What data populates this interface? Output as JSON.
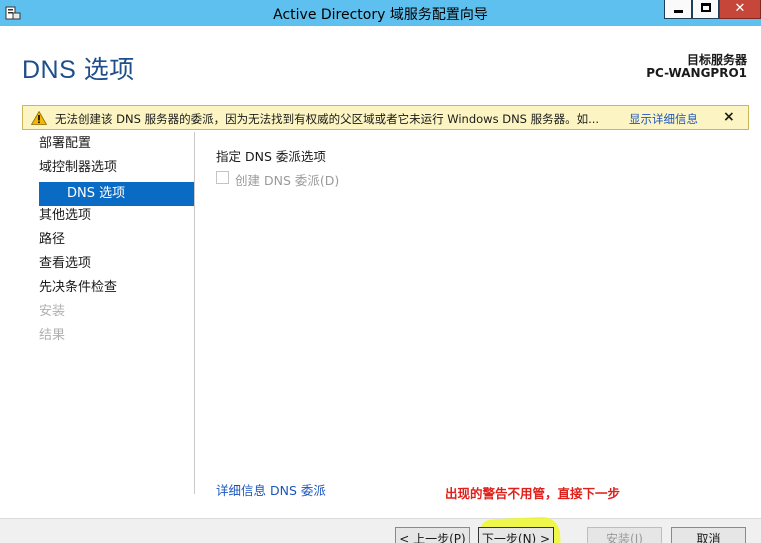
{
  "window": {
    "title": "Active Directory 域服务配置向导",
    "icon": "server-wizard-icon"
  },
  "header": {
    "page_title": "DNS 选项",
    "target_label": "目标服务器",
    "target_server": "PC-WANGPRO1"
  },
  "warning": {
    "icon": "warning-icon",
    "text": "无法创建该 DNS 服务器的委派，因为无法找到有权威的父区域或者它未运行 Windows DNS 服务器。如...",
    "link": "显示详细信息",
    "close": "×"
  },
  "nav": {
    "items": [
      {
        "label": "部署配置",
        "state": "normal"
      },
      {
        "label": "域控制器选项",
        "state": "normal"
      },
      {
        "label": "DNS 选项",
        "state": "active"
      },
      {
        "label": "其他选项",
        "state": "normal"
      },
      {
        "label": "路径",
        "state": "normal"
      },
      {
        "label": "查看选项",
        "state": "normal"
      },
      {
        "label": "先决条件检查",
        "state": "normal"
      },
      {
        "label": "安装",
        "state": "disabled"
      },
      {
        "label": "结果",
        "state": "disabled"
      }
    ]
  },
  "main": {
    "section_label": "指定 DNS 委派选项",
    "checkbox_label": "创建 DNS 委派(D)",
    "checkbox_checked": false,
    "more_link": "详细信息 DNS 委派",
    "annotation": "出现的警告不用管，直接下一步"
  },
  "footer": {
    "prev": "< 上一步(P)",
    "next": "下一步(N) >",
    "install": "安装(I)",
    "cancel": "取消"
  },
  "colors": {
    "titlebar": "#5ec0ee",
    "accent": "#0a6bc4",
    "link": "#1b55c0",
    "warning_bg": "#fcf5c3",
    "annotation": "#e0201a",
    "highlight": "#f0fa14"
  }
}
